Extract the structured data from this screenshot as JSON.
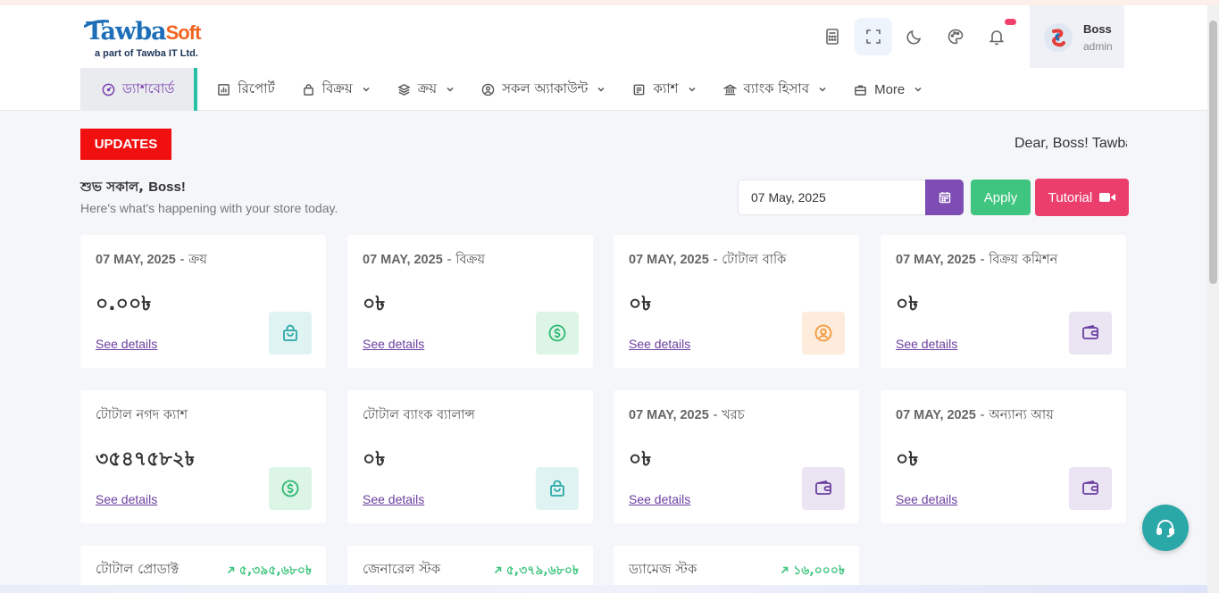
{
  "header": {
    "logo_brand": "Tawba",
    "logo_brand_suffix": "Soft",
    "logo_tagline": "a part of Tawba IT Ltd.",
    "user_name": "Boss",
    "user_role": "admin",
    "icons": [
      "calculator-icon",
      "fullscreen-icon",
      "moon-icon",
      "palette-icon",
      "bell-icon"
    ]
  },
  "nav": {
    "items": [
      {
        "label": "ড্যাশবোর্ড",
        "icon": "dashboard-icon",
        "active": true
      },
      {
        "label": "রিপোর্ট",
        "icon": "report-icon"
      },
      {
        "label": "বিক্রয়",
        "icon": "bag-icon",
        "dropdown": true
      },
      {
        "label": "ক্রয়",
        "icon": "layers-icon",
        "dropdown": true
      },
      {
        "label": "সকল অ্যাকাউন্ট",
        "icon": "user-circle-icon",
        "dropdown": true
      },
      {
        "label": "ক্যাশ",
        "icon": "cash-icon",
        "dropdown": true
      },
      {
        "label": "ব্যাংক হিসাব",
        "icon": "bank-icon",
        "dropdown": true
      },
      {
        "label": "More",
        "icon": "briefcase-icon",
        "dropdown": true
      }
    ]
  },
  "updates": {
    "label": "UPDATES",
    "marquee": "Dear, Boss! Tawba"
  },
  "greeting": {
    "title": "শুভ সকাল,",
    "name": "Boss!",
    "subtitle": "Here's what's happening with your store today."
  },
  "filter": {
    "date": "07 May, 2025",
    "apply": "Apply",
    "tutorial": "Tutorial"
  },
  "cards": [
    {
      "date": "07 MAY, 2025",
      "title": " - ক্রয়",
      "value": "০.০০৳",
      "link": "See details",
      "icon": "shopping-bag-icon",
      "color": "teal"
    },
    {
      "date": "07 MAY, 2025",
      "title": " - বিক্রয়",
      "value": "০৳",
      "link": "See details",
      "icon": "dollar-circle-icon",
      "color": "green"
    },
    {
      "date": "07 MAY, 2025",
      "title": " - টোটাল বাকি",
      "value": "০৳",
      "link": "See details",
      "icon": "user-circle-icon",
      "color": "orange"
    },
    {
      "date": "07 MAY, 2025",
      "title": " - বিক্রয় কমিশন",
      "value": "০৳",
      "link": "See details",
      "icon": "wallet-icon",
      "color": "purple"
    },
    {
      "date": "",
      "title": "টোটাল নগদ ক্যাশ",
      "value": "৩৫৪৭৫৮২৳",
      "link": "See details",
      "icon": "dollar-circle-icon",
      "color": "green"
    },
    {
      "date": "",
      "title": "টোটাল ব্যাংক ব্যালান্স",
      "value": "০৳",
      "link": "See details",
      "icon": "shopping-bag-icon",
      "color": "teal"
    },
    {
      "date": "07 MAY, 2025",
      "title": " - খরচ",
      "value": "০৳",
      "link": "See details",
      "icon": "wallet-icon",
      "color": "purple"
    },
    {
      "date": "07 MAY, 2025",
      "title": " - অন্যান্য আয়",
      "value": "০৳",
      "link": "See details",
      "icon": "wallet-icon",
      "color": "purple"
    }
  ],
  "stock_cards": [
    {
      "label": "টোটাল প্রোডাক্ট",
      "value": "৫,৩৯৫,৬৮০৳"
    },
    {
      "label": "জেনারেল স্টক",
      "value": "৫,৩৭৯,৬৮০৳"
    },
    {
      "label": "ড্যামেজ স্টক",
      "value": "১৬,০০০৳"
    }
  ]
}
